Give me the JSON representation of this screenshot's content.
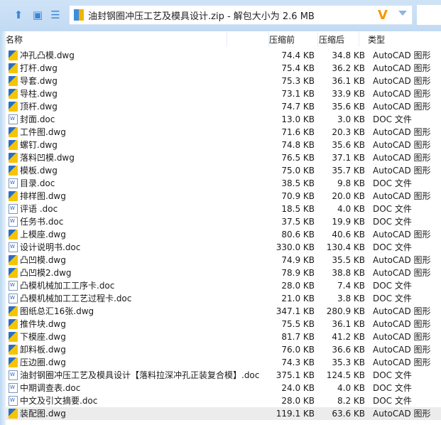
{
  "toolbar": {
    "address": "油封钢圈冲压工艺及模具设计.zip - 解包大小为 2.6 MB",
    "logo": "V"
  },
  "columns": {
    "name": "名称",
    "before": "压缩前",
    "after": "压缩后",
    "type": "类型"
  },
  "files": [
    {
      "name": "冲孔凸模.dwg",
      "before": "74.4 KB",
      "after": "34.8 KB",
      "type": "AutoCAD 图形",
      "icon": "dwg"
    },
    {
      "name": "打杆.dwg",
      "before": "75.4 KB",
      "after": "36.2 KB",
      "type": "AutoCAD 图形",
      "icon": "dwg"
    },
    {
      "name": "导套.dwg",
      "before": "75.3 KB",
      "after": "36.1 KB",
      "type": "AutoCAD 图形",
      "icon": "dwg"
    },
    {
      "name": "导柱.dwg",
      "before": "73.1 KB",
      "after": "33.9 KB",
      "type": "AutoCAD 图形",
      "icon": "dwg"
    },
    {
      "name": "顶杆.dwg",
      "before": "74.7 KB",
      "after": "35.6 KB",
      "type": "AutoCAD 图形",
      "icon": "dwg"
    },
    {
      "name": "封面.doc",
      "before": "13.0 KB",
      "after": "3.0 KB",
      "type": "DOC 文件",
      "icon": "doc"
    },
    {
      "name": "工件图.dwg",
      "before": "71.6 KB",
      "after": "20.3 KB",
      "type": "AutoCAD 图形",
      "icon": "dwg"
    },
    {
      "name": "螺钉.dwg",
      "before": "74.8 KB",
      "after": "35.6 KB",
      "type": "AutoCAD 图形",
      "icon": "dwg"
    },
    {
      "name": "落料凹模.dwg",
      "before": "76.5 KB",
      "after": "37.1 KB",
      "type": "AutoCAD 图形",
      "icon": "dwg"
    },
    {
      "name": "模板.dwg",
      "before": "75.0 KB",
      "after": "35.7 KB",
      "type": "AutoCAD 图形",
      "icon": "dwg"
    },
    {
      "name": "目录.doc",
      "before": "38.5 KB",
      "after": "9.8 KB",
      "type": "DOC 文件",
      "icon": "doc"
    },
    {
      "name": "排样图.dwg",
      "before": "70.9 KB",
      "after": "20.0 KB",
      "type": "AutoCAD 图形",
      "icon": "dwg"
    },
    {
      "name": "评语 .doc",
      "before": "18.5 KB",
      "after": "4.0 KB",
      "type": "DOC 文件",
      "icon": "doc"
    },
    {
      "name": "任务书.doc",
      "before": "37.5 KB",
      "after": "19.9 KB",
      "type": "DOC 文件",
      "icon": "doc"
    },
    {
      "name": "上模座.dwg",
      "before": "80.6 KB",
      "after": "40.6 KB",
      "type": "AutoCAD 图形",
      "icon": "dwg"
    },
    {
      "name": "设计说明书.doc",
      "before": "330.0 KB",
      "after": "130.4 KB",
      "type": "DOC 文件",
      "icon": "doc"
    },
    {
      "name": "凸凹模.dwg",
      "before": "74.9 KB",
      "after": "35.5 KB",
      "type": "AutoCAD 图形",
      "icon": "dwg"
    },
    {
      "name": "凸凹模2.dwg",
      "before": "78.9 KB",
      "after": "38.8 KB",
      "type": "AutoCAD 图形",
      "icon": "dwg"
    },
    {
      "name": "凸模机械加工工序卡.doc",
      "before": "28.0 KB",
      "after": "7.4 KB",
      "type": "DOC 文件",
      "icon": "doc"
    },
    {
      "name": "凸模机械加工工艺过程卡.doc",
      "before": "21.0 KB",
      "after": "3.8 KB",
      "type": "DOC 文件",
      "icon": "doc"
    },
    {
      "name": "图纸总汇16张.dwg",
      "before": "347.1 KB",
      "after": "280.9 KB",
      "type": "AutoCAD 图形",
      "icon": "dwg"
    },
    {
      "name": "推件块.dwg",
      "before": "75.5 KB",
      "after": "36.1 KB",
      "type": "AutoCAD 图形",
      "icon": "dwg"
    },
    {
      "name": "下模座.dwg",
      "before": "81.7 KB",
      "after": "41.2 KB",
      "type": "AutoCAD 图形",
      "icon": "dwg"
    },
    {
      "name": "卸料板.dwg",
      "before": "76.0 KB",
      "after": "36.6 KB",
      "type": "AutoCAD 图形",
      "icon": "dwg"
    },
    {
      "name": "压边圈.dwg",
      "before": "74.3 KB",
      "after": "35.3 KB",
      "type": "AutoCAD 图形",
      "icon": "dwg"
    },
    {
      "name": "油封钢圈冲压工艺及模具设计【落料拉深冲孔正装复合模】.doc",
      "before": "375.1 KB",
      "after": "124.5 KB",
      "type": "DOC 文件",
      "icon": "doc"
    },
    {
      "name": "中期调查表.doc",
      "before": "24.0 KB",
      "after": "4.0 KB",
      "type": "DOC 文件",
      "icon": "doc"
    },
    {
      "name": "中文及引文摘要.doc",
      "before": "28.0 KB",
      "after": "8.2 KB",
      "type": "DOC 文件",
      "icon": "doc"
    },
    {
      "name": "装配图.dwg",
      "before": "119.1 KB",
      "after": "63.6 KB",
      "type": "AutoCAD 图形",
      "icon": "dwg"
    }
  ]
}
